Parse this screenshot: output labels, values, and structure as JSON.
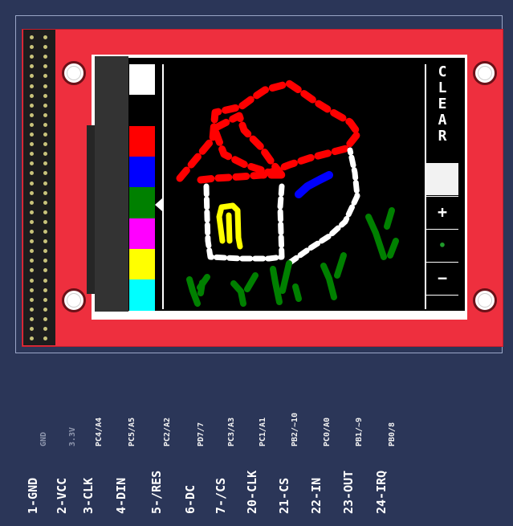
{
  "display": {
    "clear_button": {
      "letters": [
        "C",
        "L",
        "E",
        "A",
        "R"
      ]
    },
    "plus_label": "+",
    "dot_label": "•",
    "minus_label": "−",
    "palette": [
      {
        "name": "white",
        "color": "#ffffff"
      },
      {
        "name": "black",
        "color": "#000000"
      },
      {
        "name": "red",
        "color": "#ff0000"
      },
      {
        "name": "blue",
        "color": "#0000ff"
      },
      {
        "name": "green",
        "color": "#008000"
      },
      {
        "name": "magenta",
        "color": "#ff00ff"
      },
      {
        "name": "yellow",
        "color": "#ffff00"
      },
      {
        "name": "cyan",
        "color": "#00ffff"
      }
    ],
    "selected_color": "green",
    "drawing_colors": {
      "roof": "#ff0000",
      "walls": "#ffffff",
      "door": "#ffff00",
      "window": "#0000ff",
      "grass": "#008000"
    }
  },
  "pins": [
    {
      "main": "1-GND",
      "sub": "GND"
    },
    {
      "main": "2-VCC",
      "sub": "3.3V"
    },
    {
      "main": "3-CLK",
      "sub": "PC4/A4"
    },
    {
      "main": "4-DIN",
      "sub": "PC5/A5"
    },
    {
      "main": "5-/RES",
      "sub": "PC2/A2"
    },
    {
      "main": "6-DC",
      "sub": "PD7/7"
    },
    {
      "main": "7-/CS",
      "sub": "PC3/A3"
    },
    {
      "main": "20-CLK",
      "sub": "PC1/A1"
    },
    {
      "main": "21-CS",
      "sub": "PB2/~10"
    },
    {
      "main": "22-IN",
      "sub": "PC0/A0"
    },
    {
      "main": "23-OUT",
      "sub": "PB1/~9"
    },
    {
      "main": "24-IRQ",
      "sub": "PB0/8"
    }
  ]
}
